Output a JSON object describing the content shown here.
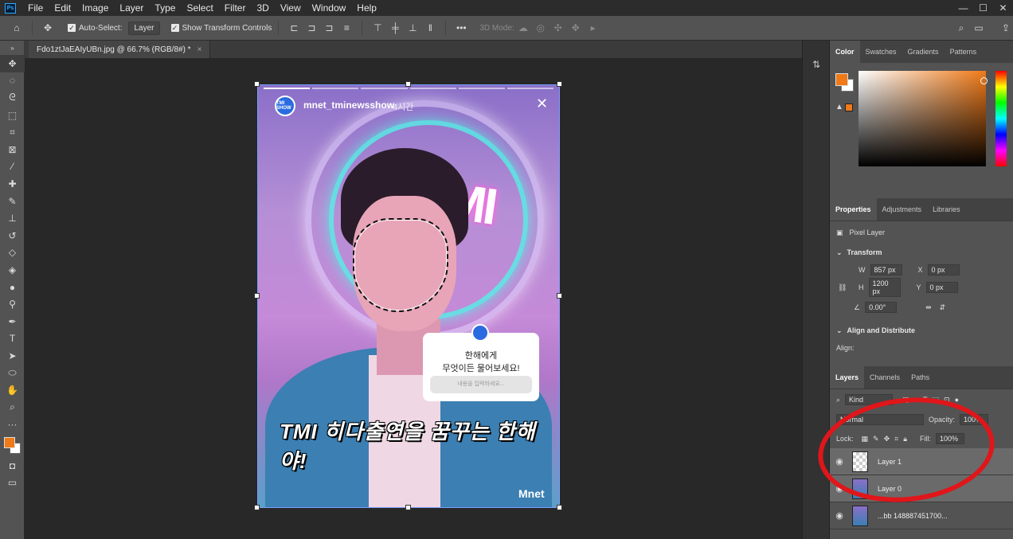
{
  "app": {
    "menu": [
      "File",
      "Edit",
      "Image",
      "Layer",
      "Type",
      "Select",
      "Filter",
      "3D",
      "View",
      "Window",
      "Help"
    ],
    "window_controls": {
      "minimize": "—",
      "maximize": "☐",
      "close": "✕"
    }
  },
  "options_bar": {
    "auto_select_label": "Auto-Select:",
    "auto_select_value": "Layer",
    "show_transform_label": "Show Transform Controls",
    "mode_3d_label": "3D Mode:",
    "more_label": "•••"
  },
  "document": {
    "tab_title": "Fdo1ztJaEAIyUBn.jpg @ 66.7% (RGB/8#) *",
    "close_label": "×"
  },
  "canvas": {
    "story_user": "mnet_tminewsshow",
    "story_time": "4시간",
    "story_avatar_text": "TMI SHOW",
    "close_label": "✕",
    "sign_text": "TMI",
    "question_line1": "한해에게",
    "question_line2": "무엇이든 물어보세요!",
    "question_placeholder": "내용을 입력하세요...",
    "caption": "TMI 히다출연을 꿈꾸는  한해야!",
    "brand": "Mnet"
  },
  "color_panel": {
    "tabs": [
      "Color",
      "Swatches",
      "Gradients",
      "Patterns"
    ],
    "foreground": "#f07a18",
    "background": "#ffffff"
  },
  "properties_panel": {
    "tabs": [
      "Properties",
      "Adjustments",
      "Libraries"
    ],
    "layer_type": "Pixel Layer",
    "transform_header": "Transform",
    "w_label": "W",
    "w_value": "857 px",
    "h_label": "H",
    "h_value": "1200 px",
    "x_label": "X",
    "x_value": "0 px",
    "y_label": "Y",
    "y_value": "0 px",
    "angle_value": "0.00°",
    "align_header": "Align and Distribute",
    "align_label": "Align:"
  },
  "layers_panel": {
    "tabs": [
      "Layers",
      "Channels",
      "Paths"
    ],
    "filter_kind": "Kind",
    "blend_mode": "Normal",
    "opacity_label": "Opacity:",
    "opacity_value": "100%",
    "lock_label": "Lock:",
    "fill_label": "Fill:",
    "fill_value": "100%",
    "layers": [
      {
        "name": "Layer 1"
      },
      {
        "name": "Layer 0"
      },
      {
        "name": "...bb 148887451700..."
      }
    ]
  },
  "annotation": {
    "color": "#e0161a"
  }
}
